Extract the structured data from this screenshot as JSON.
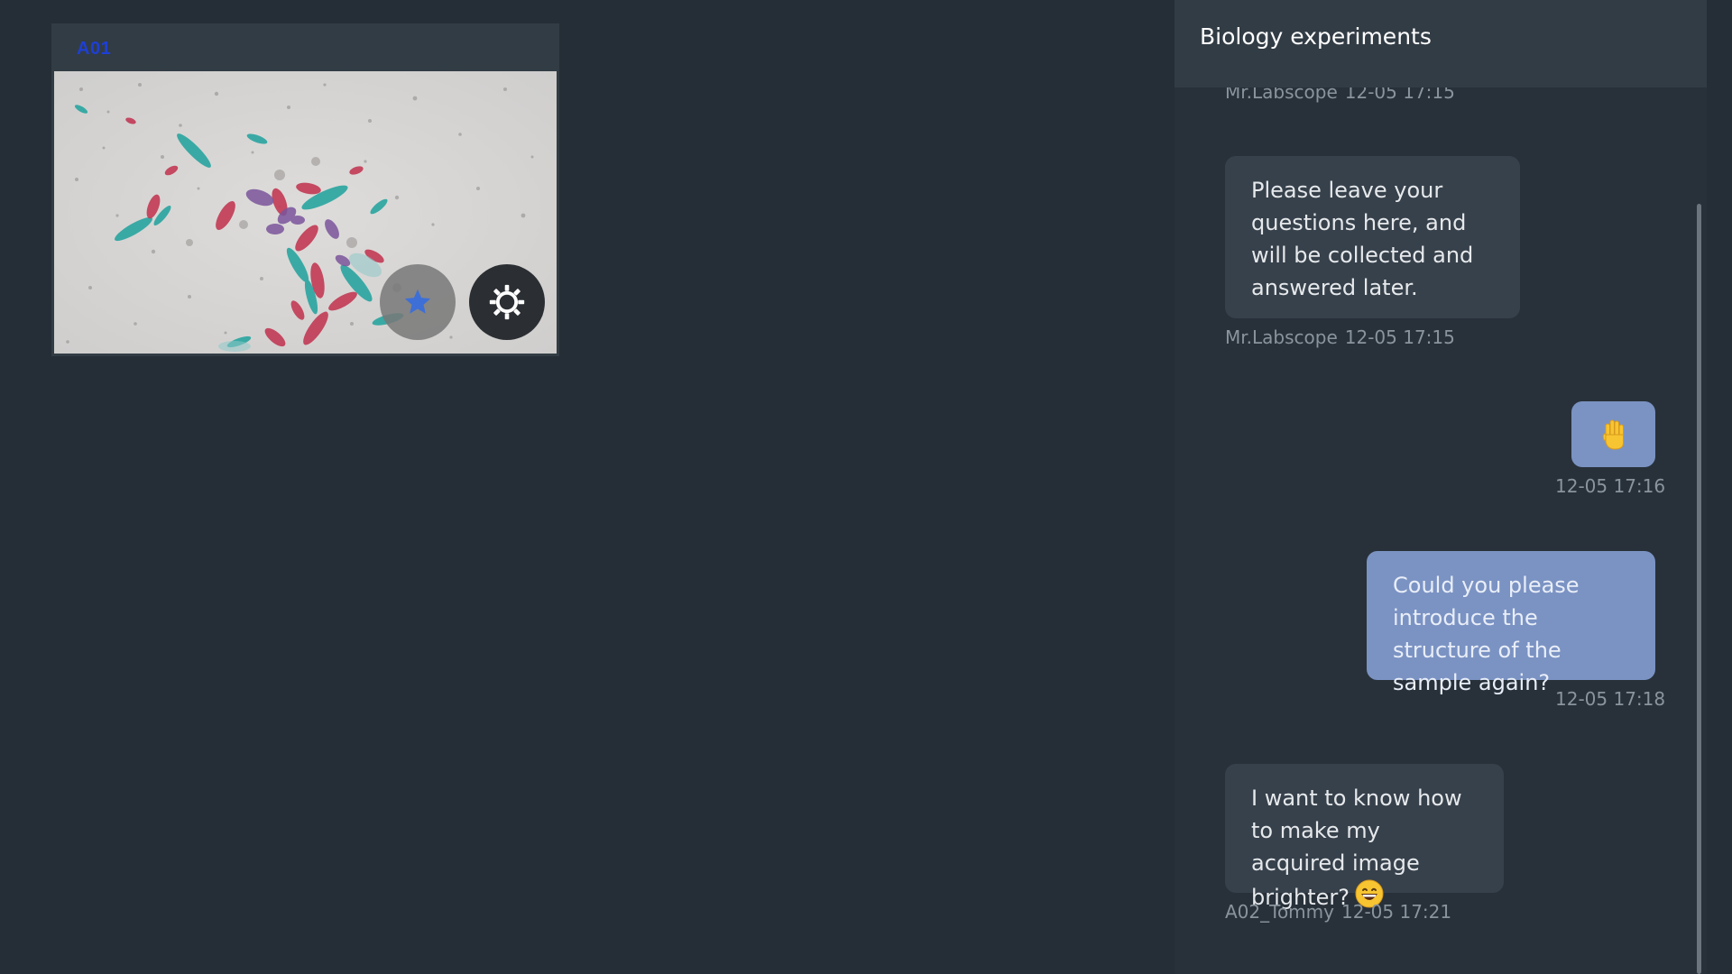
{
  "camera": {
    "label": "A01"
  },
  "chat": {
    "title": "Biology experiments",
    "messages": [
      {
        "sender": "Mr.Labscope",
        "time": "12-05 17:15",
        "text": "",
        "direction": "in"
      },
      {
        "sender": "Mr.Labscope",
        "time": "12-05 17:15",
        "text": "Please leave your questions here, and will be collected and answered later.",
        "direction": "in"
      },
      {
        "sender": "",
        "time": "12-05 17:16",
        "text": "",
        "emoji": "raised-hand-emoji",
        "direction": "out"
      },
      {
        "sender": "",
        "time": "12-05 17:18",
        "text": "Could you please introduce the structure of the sample again?",
        "direction": "out"
      },
      {
        "sender": "A02_Tommy",
        "time": "12-05 17:21",
        "text": "I want to know how to make my acquired image brighter?",
        "emoji": "grinning-face-emoji",
        "direction": "in"
      }
    ]
  },
  "colors": {
    "background": "#252e36",
    "panel": "#28313a",
    "header": "#323c45",
    "incoming_bubble": "#37414b",
    "outgoing_bubble": "#7b93c3",
    "camera_label": "#1e3fd4",
    "meta_text": "#8a949d"
  },
  "icons": {
    "star_button": "star-icon",
    "settings_button": "gear-icon"
  }
}
